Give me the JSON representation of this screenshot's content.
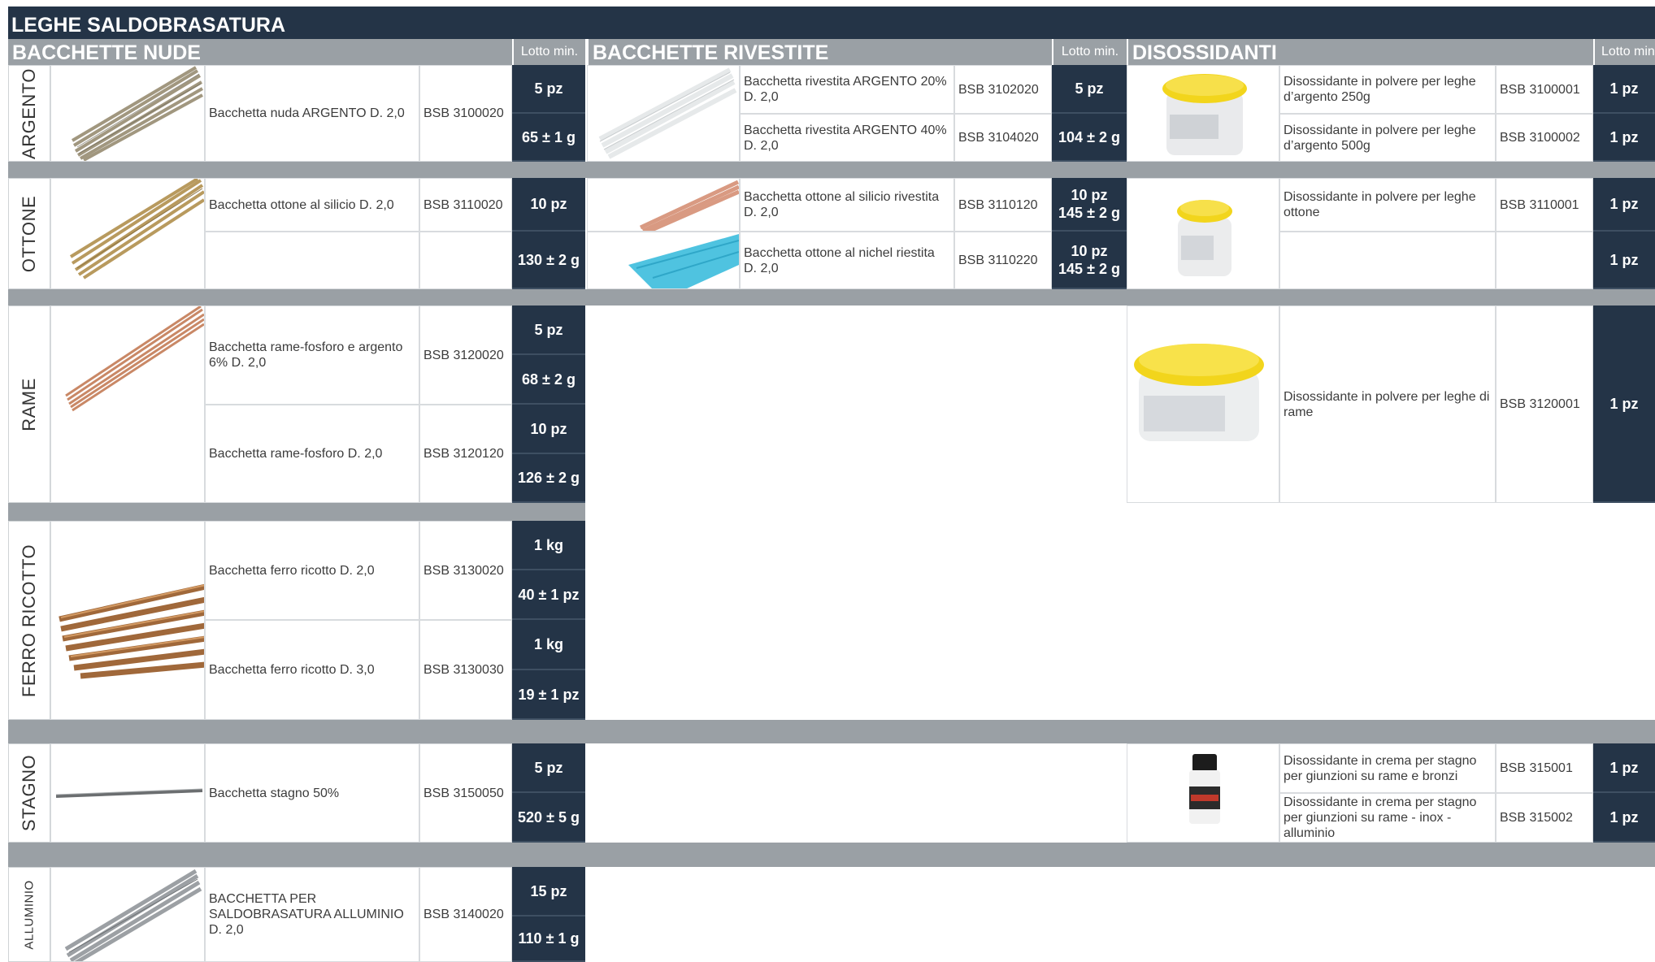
{
  "title": "LEGHE SALDOBRASATURA",
  "sections": {
    "nude": "BACCHETTE NUDE",
    "rivestite": "BACCHETTE RIVESTITE",
    "disossidanti": "DISOSSIDANTI",
    "lotto": "Lotto min.",
    "lotto_cut": "Lotto min"
  },
  "categories": {
    "argento": "ARGENTO",
    "ottone": "OTTONE",
    "rame": "RAME",
    "ferro": "FERRO RICOTTO",
    "stagno": "STAGNO",
    "alluminio": "ALLUMINIO"
  },
  "nude": {
    "argento": {
      "desc": "Bacchetta nuda ARGENTO D. 2,0",
      "code": "BSB 3100020",
      "lot1": "5 pz",
      "lot2": "65 ± 1 g"
    },
    "ottone": {
      "desc": "Bacchetta ottone al silicio D. 2,0",
      "code": "BSB 3110020",
      "lot1": "10 pz",
      "lot2": "130 ± 2 g"
    },
    "rame1": {
      "desc": "Bacchetta rame-fosforo e argento 6% D. 2,0",
      "code": "BSB 3120020",
      "lot1": "5 pz",
      "lot2": "68 ± 2 g"
    },
    "rame2": {
      "desc": "Bacchetta rame-fosforo D. 2,0",
      "code": "BSB 3120120",
      "lot1": "10 pz",
      "lot2": "126 ± 2 g"
    },
    "ferro1": {
      "desc": "Bacchetta ferro ricotto D. 2,0",
      "code": "BSB 3130020",
      "lot1": "1 kg",
      "lot2": "40 ± 1 pz"
    },
    "ferro2": {
      "desc": "Bacchetta ferro ricotto D. 3,0",
      "code": "BSB 3130030",
      "lot1": "1 kg",
      "lot2": "19 ± 1 pz"
    },
    "stagno": {
      "desc": "Bacchetta stagno 50%",
      "code": "BSB 3150050",
      "lot1": "5 pz",
      "lot2": "520 ± 5 g"
    },
    "alluminio": {
      "desc": "BACCHETTA PER SALDOBRASATURA ALLUMINIO D. 2,0",
      "code": "BSB 3140020",
      "lot1": "15 pz",
      "lot2": "110 ± 1 g"
    }
  },
  "rivestite": {
    "arg1": {
      "desc": "Bacchetta rivestita ARGENTO 20% D. 2,0",
      "code": "BSB 3102020",
      "lot": "5 pz"
    },
    "arg2": {
      "desc": "Bacchetta rivestita ARGENTO 40% D. 2,0",
      "code": "BSB 3104020",
      "lot": "104 ± 2 g"
    },
    "ott1": {
      "desc": "Bacchetta ottone al silicio rivestita D. 2,0",
      "code": "BSB 3110120",
      "lot_a": "10 pz",
      "lot_b": "145 ± 2 g"
    },
    "ott2": {
      "desc": "Bacchetta ottone al nichel riestita D. 2,0",
      "code": "BSB 3110220",
      "lot_a": "10 pz",
      "lot_b": "145 ± 2 g"
    }
  },
  "disossidanti": {
    "arg1": {
      "desc": "Disossidante in polvere per leghe d’argento 250g",
      "code": "BSB 3100001",
      "lot": "1 pz"
    },
    "arg2": {
      "desc": "Disossidante in polvere per leghe d’argento 500g",
      "code": "BSB 3100002",
      "lot": "1 pz"
    },
    "ott1": {
      "desc": "Disossidante in polvere per leghe ottone",
      "code": "BSB 3110001",
      "lot": "1 pz"
    },
    "ott2": {
      "lot": "1 pz"
    },
    "rame": {
      "desc": "Disossidante in polvere per leghe di rame",
      "code": "BSB 3120001",
      "lot": "1 pz"
    },
    "stagno1": {
      "desc": "Disossidante in crema per stagno per giunzioni su rame e bronzi",
      "code": "BSB 315001",
      "lot": "1 pz"
    },
    "stagno2": {
      "desc": "Disossidante in crema per stagno per giunzioni su rame - inox - alluminio",
      "code": "BSB 315002",
      "lot": "1 pz"
    }
  }
}
